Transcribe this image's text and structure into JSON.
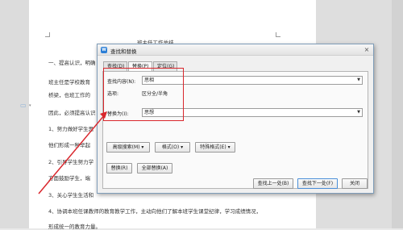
{
  "document": {
    "heading": "班主任工作总结",
    "lines": [
      "一、提高认识，明确",
      "班主任是学校教育",
      "桥梁，也班工作的",
      "因此，必须提高认识",
      "1、努力做好学生思",
      "他们形成一种早起",
      "2、引导学生努力学",
      "方面鼓励学生，端",
      "3、关心学生生活和",
      "4、协调本班任课教师的教育教学工作，主动向他们了解本班学生课堂纪律，学习成绩情况，",
      "形成统一的教育力量。"
    ]
  },
  "dialog": {
    "title": "查找和替换",
    "app_icon_glyph": "W",
    "close_glyph": "×",
    "tabs": [
      {
        "label": "查找(D)"
      },
      {
        "label": "替换(P)"
      },
      {
        "label": "定位(G)"
      }
    ],
    "find_label": "查找内容(N):",
    "find_value": "思相",
    "options_label": "选项:",
    "options_value": "区分全/半角",
    "replace_label": "替换为(I):",
    "replace_value": "思想",
    "advanced_button": "高级搜索(M) ▾",
    "format_button": "格式(O) ▾",
    "special_button": "特殊格式(E) ▾",
    "replace_button": "替换(R)",
    "replace_all_button": "全部替换(A)",
    "find_prev_button": "查找上一处(B)",
    "find_next_button": "查找下一处(F)",
    "close_button": "关闭"
  },
  "colors": {
    "annotation": "#d9262c",
    "accent": "#2c7fd6"
  }
}
